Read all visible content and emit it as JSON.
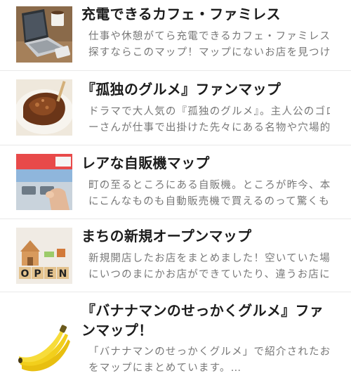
{
  "items": [
    {
      "title": "充電できるカフェ・ファミレス",
      "desc_line1": "仕事や休憩がてら充電できるカフェ・ファミレスを",
      "desc_line2": "探すならこのマップ！マップにないお店を見つけ…",
      "thumb_icon": "laptop-cafe-icon"
    },
    {
      "title": "『孤独のグルメ』ファンマップ",
      "desc_line1": "ドラマで大人気の『孤独のグルメ』。主人公のゴロ",
      "desc_line2": "ーさんが仕事で出掛けた先々にある名物や穴場的…",
      "thumb_icon": "grilled-meat-icon"
    },
    {
      "title": "レアな自販機マップ",
      "desc_line1": "町の至るところにある自販機。ところが昨今、本当",
      "desc_line2": "にこんなものも自動販売機で買えるのって驚くも…",
      "thumb_icon": "vending-machine-icon"
    },
    {
      "title": "まちの新規オープンマップ",
      "desc_line1": "新規開店したお店をまとめました！空いていた場所",
      "desc_line2": "にいつのまにかお店ができていたり、違うお店に…",
      "thumb_icon": "open-blocks-icon",
      "thumb_text": "OPEN"
    },
    {
      "title_line1": "『バナナマンのせっかくグルメ』ファ",
      "title_line2": "ンマップ！",
      "desc_line1": "「バナナマンのせっかくグルメ」で紹介されたお店",
      "desc_line2": "をマップにまとめています。…",
      "thumb_icon": "banana-icon"
    }
  ]
}
